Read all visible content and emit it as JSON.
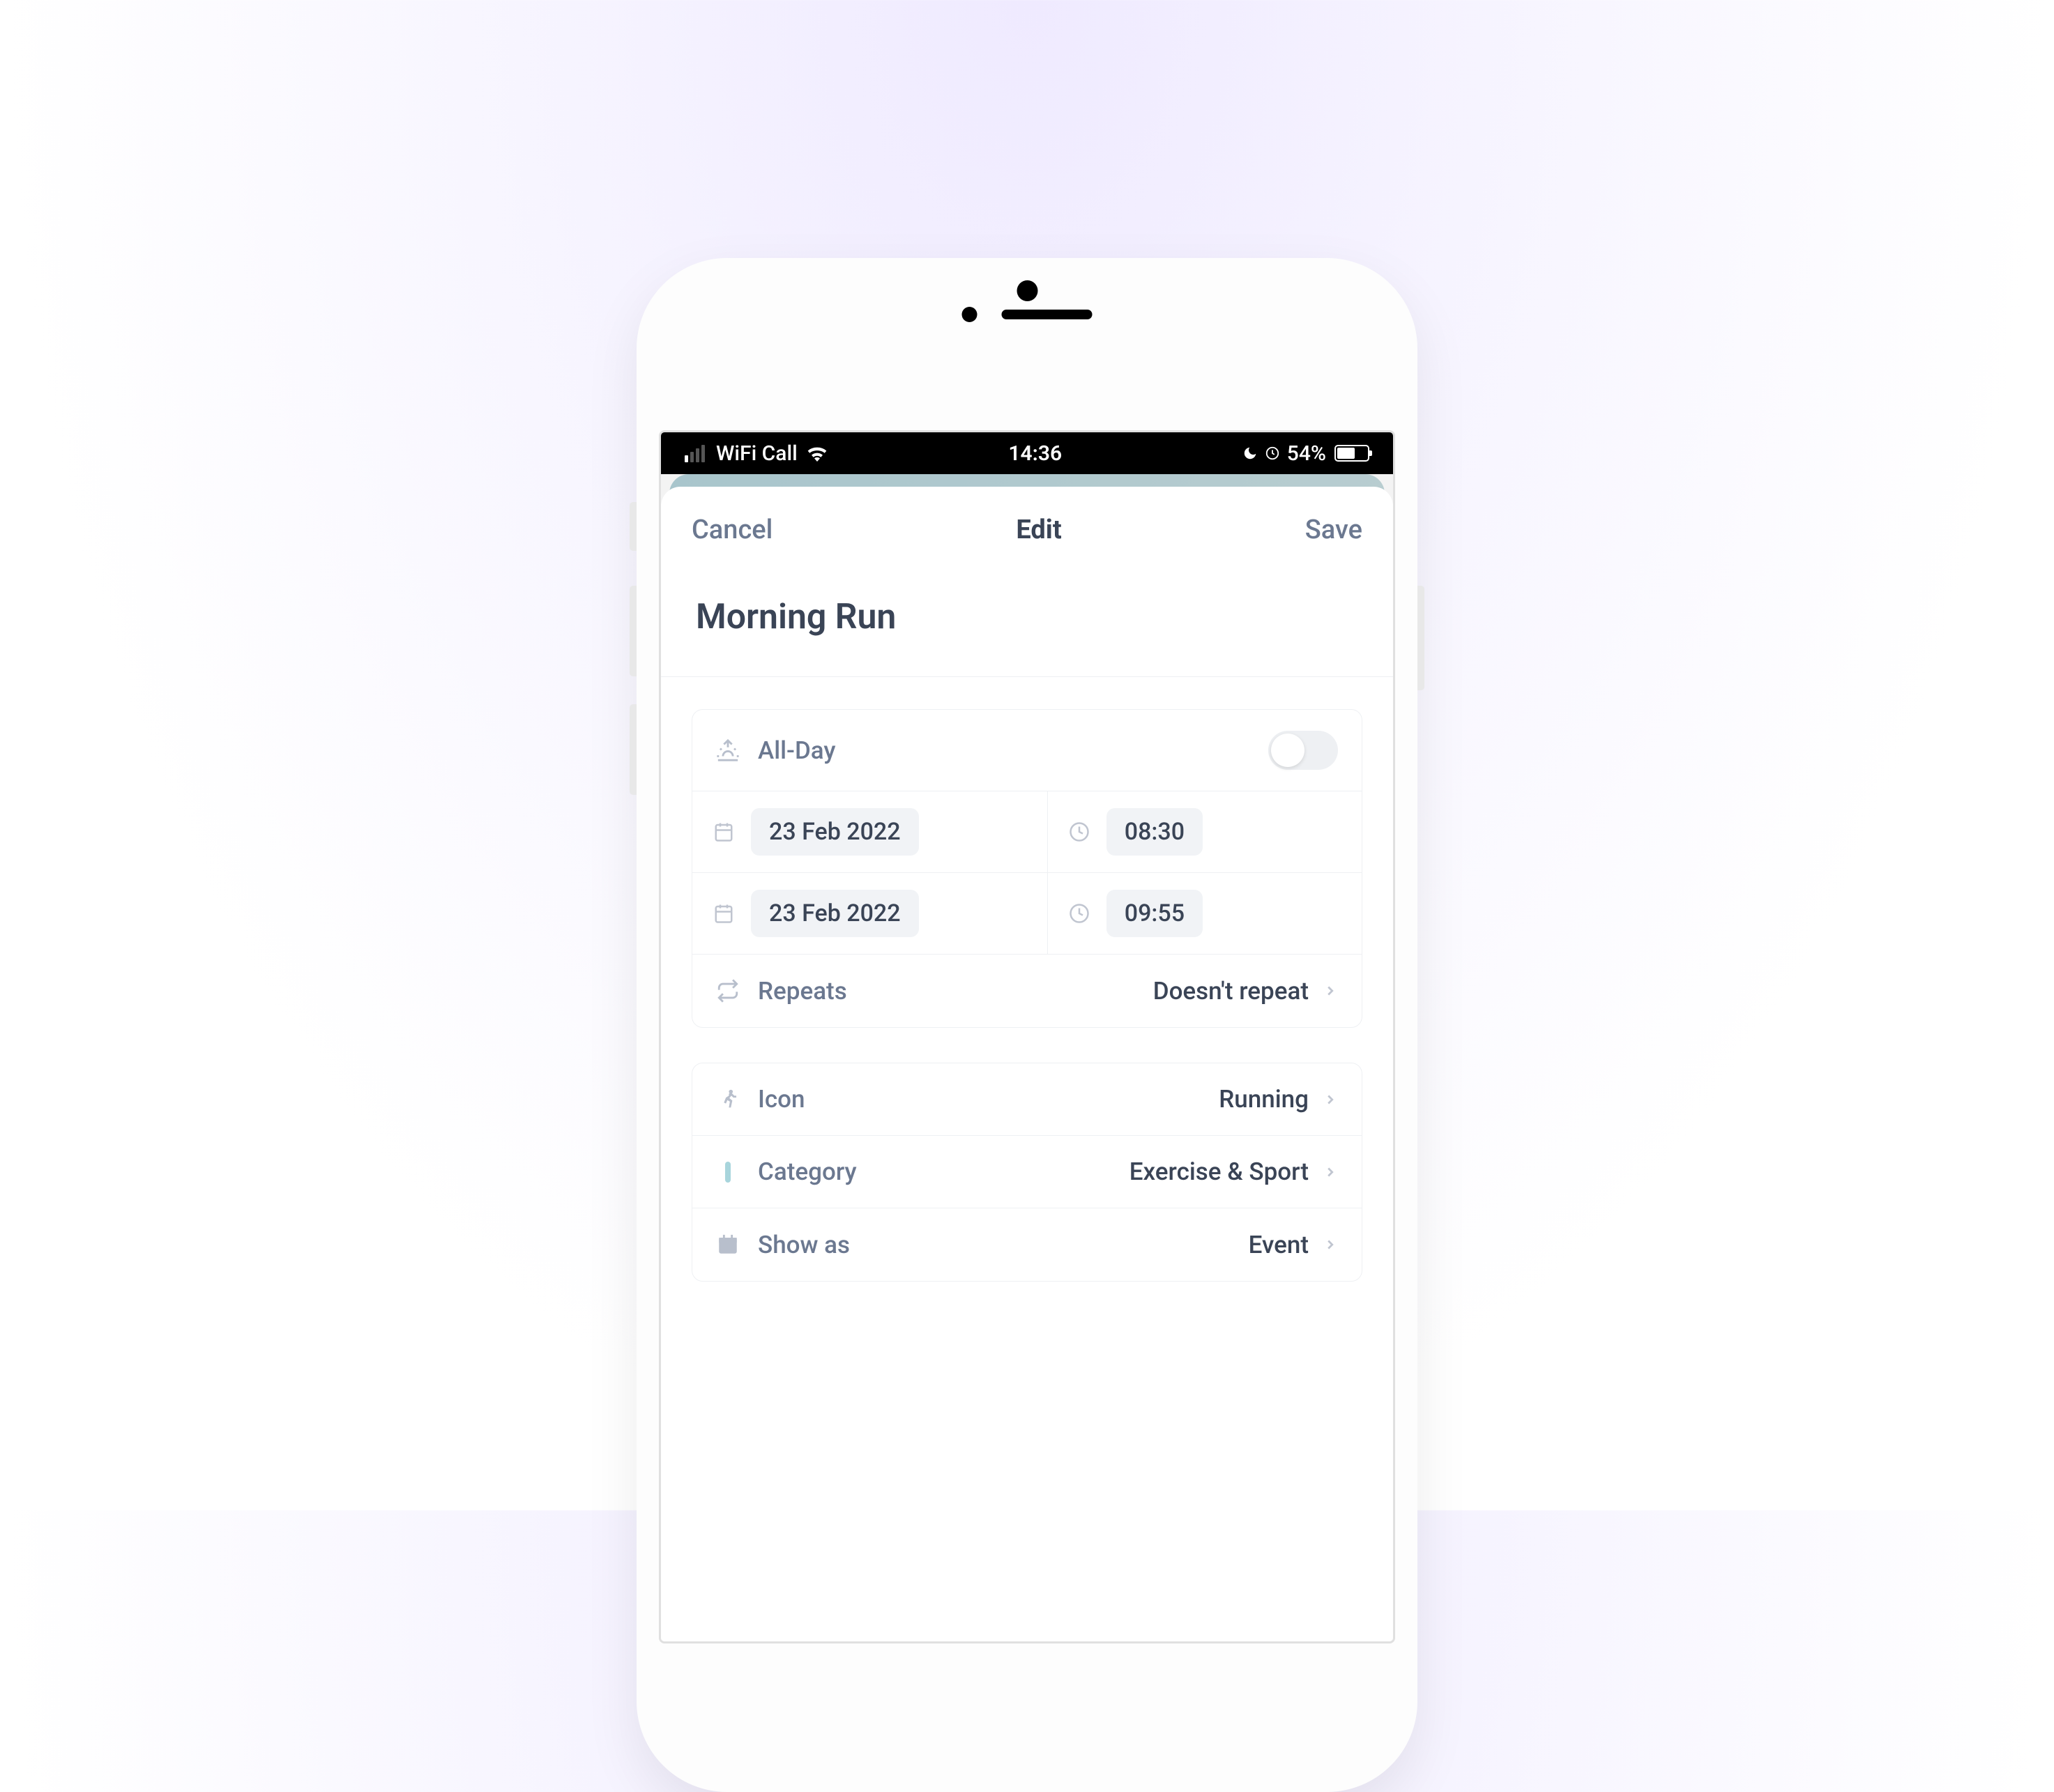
{
  "status_bar": {
    "carrier": "WiFi Call",
    "time": "14:36",
    "battery_pct": "54%"
  },
  "modal": {
    "cancel_label": "Cancel",
    "title": "Edit",
    "save_label": "Save"
  },
  "event": {
    "title": "Morning Run"
  },
  "section1": {
    "allday_label": "All-Day",
    "allday_enabled": false,
    "start_date": "23 Feb 2022",
    "start_time": "08:30",
    "end_date": "23 Feb 2022",
    "end_time": "09:55",
    "repeats_label": "Repeats",
    "repeats_value": "Doesn't repeat"
  },
  "section2": {
    "icon_label": "Icon",
    "icon_value": "Running",
    "category_label": "Category",
    "category_value": "Exercise & Sport",
    "category_color": "#a8d5dc",
    "showas_label": "Show as",
    "showas_value": "Event"
  }
}
